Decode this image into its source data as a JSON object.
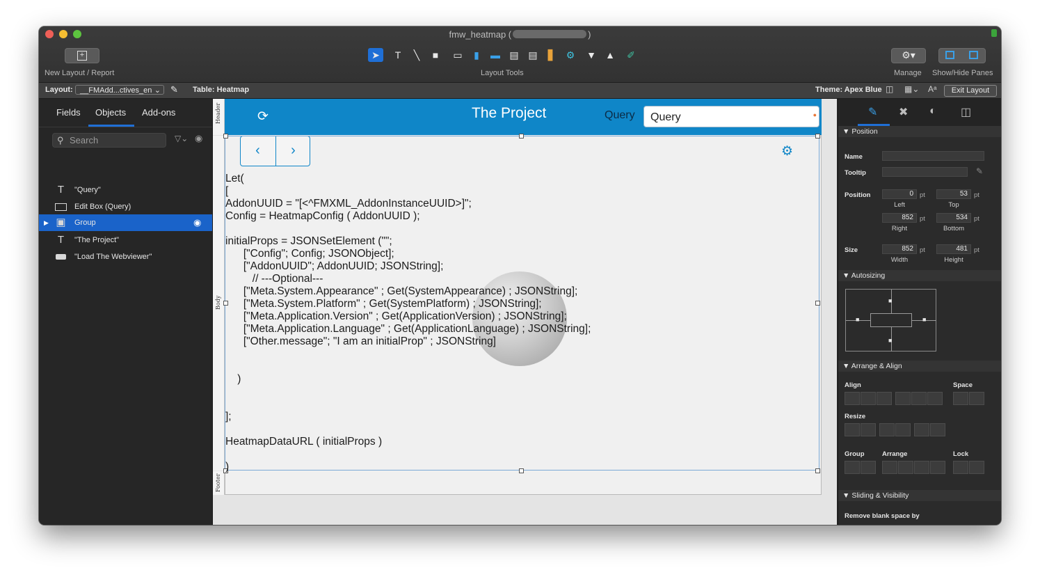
{
  "window": {
    "title": "fmw_heatmap (",
    "title_suffix": ")"
  },
  "toolbar": {
    "new_layout_label": "New Layout / Report",
    "layout_tools_label": "Layout Tools",
    "manage_label": "Manage",
    "show_hide_label": "Show/Hide Panes"
  },
  "layout_bar": {
    "layout_label": "Layout:",
    "layout_value": "__FMAdd...ctives_en",
    "table_label": "Table: Heatmap",
    "theme_label": "Theme: Apex Blue",
    "exit_label": "Exit Layout"
  },
  "left_pane": {
    "tabs": [
      "Fields",
      "Objects",
      "Add-ons"
    ],
    "search_placeholder": "Search",
    "objects": [
      {
        "label": "\"Query\"",
        "icon": "text-icon"
      },
      {
        "label": "Edit Box (Query)",
        "icon": "edit-box-icon"
      },
      {
        "label": "Group",
        "icon": "group-icon"
      },
      {
        "label": "\"The Project\"",
        "icon": "text-icon"
      },
      {
        "label": "\"Load The Webviewer\"",
        "icon": "button-icon"
      }
    ]
  },
  "canvas": {
    "parts": {
      "header": "Header",
      "body": "Body",
      "footer": "Footer"
    },
    "project_title": "The Project",
    "query_label": "Query",
    "query_value": "Query",
    "code": "Let(\n[\nAddonUUID = \"[<^FMXML_AddonInstanceUUID>]\";\nConfig = HeatmapConfig ( AddonUUID );\n\ninitialProps = JSONSetElement (\"\";\n      [\"Config\"; Config; JSONObject];\n      [\"AddonUUID\"; AddonUUID; JSONString];\n         // ---Optional---\n      [\"Meta.System.Appearance\" ; Get(SystemAppearance) ; JSONString];\n      [\"Meta.System.Platform\" ; Get(SystemPlatform) ; JSONString];\n      [\"Meta.Application.Version\" ; Get(ApplicationVersion) ; JSONString];\n      [\"Meta.Application.Language\" ; Get(ApplicationLanguage) ; JSONString];\n      [\"Other.message\"; \"I am an initialProp\" ; JSONString]\n\n\n    )\n\n\n];\n\nHeatmapDataURL ( initialProps )\n\n)"
  },
  "inspector": {
    "position_head": "Position",
    "name_label": "Name",
    "tooltip_label": "Tooltip",
    "position_label": "Position",
    "left": "0",
    "top": "53",
    "right": "852",
    "bottom": "534",
    "left_label": "Left",
    "top_label": "Top",
    "right_label": "Right",
    "bottom_label": "Bottom",
    "size_label": "Size",
    "width": "852",
    "height": "481",
    "width_label": "Width",
    "height_label": "Height",
    "unit": "pt",
    "autosizing_head": "Autosizing",
    "arrange_head": "Arrange & Align",
    "align_label": "Align",
    "space_label": "Space",
    "resize_label": "Resize",
    "group_label": "Group",
    "arrange_label": "Arrange",
    "lock_label": "Lock",
    "sliding_head": "Sliding & Visibility",
    "remove_blank_label": "Remove blank space by"
  }
}
